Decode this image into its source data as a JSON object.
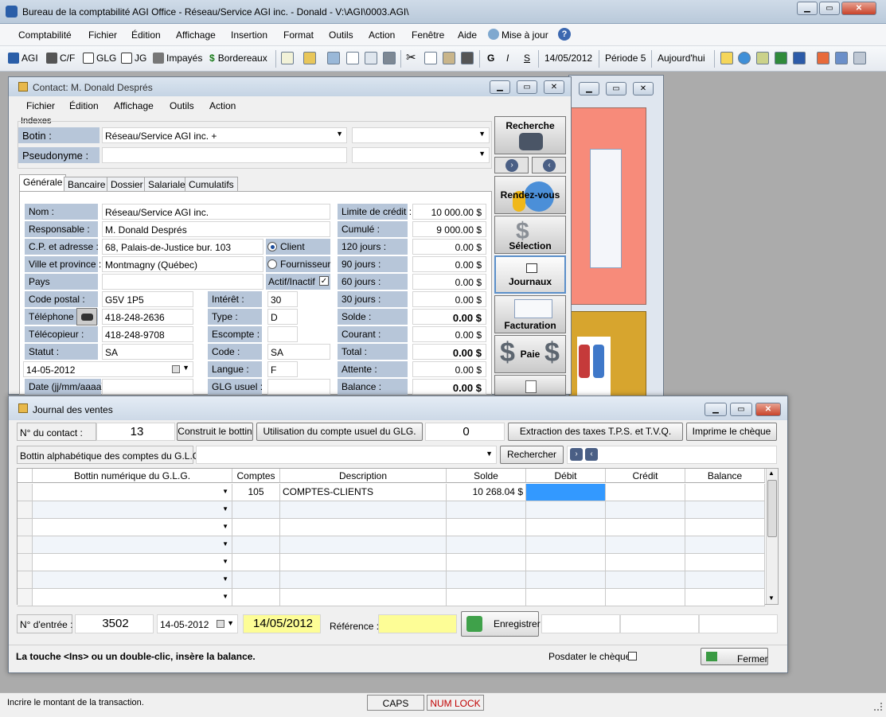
{
  "app_title": "Bureau de la comptabilité AGI Office - Réseau/Service AGI inc. - Donald - V:\\AGI\\0003.AGI\\",
  "menu": [
    "Comptabilité",
    "Fichier",
    "Édition",
    "Affichage",
    "Insertion",
    "Format",
    "Outils",
    "Action",
    "Fenêtre",
    "Aide",
    "Mise à jour"
  ],
  "toolbar": {
    "agi": "AGI",
    "cf": "C/F",
    "glg": "GLG",
    "jg": "JG",
    "impayes": "Impayés",
    "bordereaux": "Bordereaux",
    "bold": "G",
    "italic": "I",
    "underline": "S",
    "date": "14/05/2012",
    "periode": "Période 5",
    "aujourdhui": "Aujourd'hui"
  },
  "contact": {
    "title": "Contact: M. Donald Després",
    "menu": [
      "Fichier",
      "Édition",
      "Affichage",
      "Outils",
      "Action"
    ],
    "indexes": "Indexes",
    "botin_label": "Botin :",
    "botin_value": "Réseau/Service AGI inc.  +",
    "pseudo_label": "Pseudonyme :",
    "tabs": [
      "Générale",
      "Bancaire",
      "Dossier",
      "Salariale",
      "Cumulatifs"
    ],
    "nom_label": "Nom :",
    "nom": "Réseau/Service AGI inc.",
    "resp_label": "Responsable :",
    "resp": "M. Donald Després",
    "adr_label": "C.P. et adresse :",
    "adr": "68, Palais-de-Justice bur. 103",
    "ville_label": "Ville et province :",
    "ville": "Montmagny (Québec)",
    "pays_label": "Pays",
    "cp_label": "Code postal :",
    "cp": "G5V 1P5",
    "tel_label": "Téléphone :",
    "tel": "418-248-2636",
    "fax_label": "Télécopieur :",
    "fax": "418-248-9708",
    "statut_label": "Statut :",
    "statut": "SA",
    "date_value": "14-05-2012",
    "datefmt_label": "Date (jj/mm/aaaa):",
    "client": "Client",
    "fournisseur": "Fournisseur",
    "actif": "Actif/Inactif",
    "interet_label": "Intérêt :",
    "interet": "30",
    "type_label": "Type :",
    "type": "D",
    "escompte_label": "Escompte :",
    "code_label": "Code :",
    "code": "SA",
    "langue_label": "Langue :",
    "langue": "F",
    "glg_label": "GLG usuel :",
    "fin_labels": [
      "Limite de crédit :",
      "Cumulé :",
      "120 jours :",
      "90 jours :",
      "60 jours :",
      "30 jours :",
      "Solde :",
      "Courant :",
      "Total :",
      "Attente :",
      "Balance :"
    ],
    "fin_values": [
      "10 000.00 $",
      "9 000.00 $",
      "0.00 $",
      "0.00 $",
      "0.00 $",
      "0.00 $",
      "0.00 $",
      "0.00 $",
      "0.00 $",
      "0.00 $",
      "0.00 $"
    ],
    "side_buttons": [
      "Recherche",
      "Rendez-vous",
      "Sélection",
      "Journaux",
      "Facturation",
      "Paie"
    ]
  },
  "journal": {
    "title": "Journal des ventes",
    "contact_label": "N° du contact :",
    "contact_no": "13",
    "btn_construit": "Construit le bottin",
    "btn_utilisation": "Utilisation du compte usuel du GLG.",
    "counter": "0",
    "btn_extraction": "Extraction des taxes T.P.S. et T.V.Q.",
    "btn_imprime": "Imprime le chèque",
    "bottin_label": "Bottin alphabétique des comptes du G.L.G. :",
    "btn_rechercher": "Rechercher",
    "columns": [
      "Bottin numérique du G.L.G.",
      "Comptes",
      "Description",
      "Solde",
      "Débit",
      "Crédit",
      "Balance"
    ],
    "row": {
      "compte": "105",
      "description": "COMPTES-CLIENTS",
      "solde": "10 268.04 $"
    },
    "entree_label": "N° d'entrée :",
    "entree": "3502",
    "date_small": "14-05-2012",
    "date_big": "14/05/2012",
    "reference_label": "Référence :",
    "btn_enregistrer": "Enregistrer",
    "hint": "La touche <Ins> ou un double-clic, insère la balance.",
    "postdater": "Posdater le chèque",
    "btn_fermer": "Fermer"
  },
  "statusbar": {
    "message": "Incrire le montant de la transaction.",
    "caps": "CAPS",
    "numlock": "NUM LOCK"
  },
  "colors": {
    "label_bg": "#b7c6d9",
    "yellow": "#fdfd96",
    "selected_cell": "#3399ff",
    "salmon": "#f78b7a",
    "gold": "#d7a52e"
  }
}
